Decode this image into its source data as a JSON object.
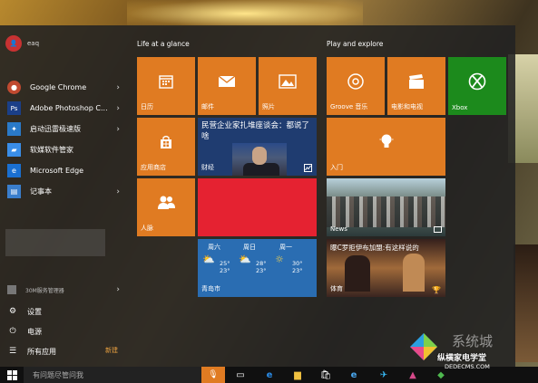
{
  "user": {
    "name": "eaq"
  },
  "apps": [
    {
      "label": "Google Chrome",
      "icon": "chrome-icon",
      "arrow": true,
      "color": "#c04a30"
    },
    {
      "label": "Adobe Photoshop C...",
      "icon": "photoshop-icon",
      "arrow": true,
      "color": "#1b3f88"
    },
    {
      "label": "启动迅雷极速版",
      "icon": "thunder-icon",
      "arrow": true,
      "color": "#2a7ac8"
    },
    {
      "label": "软媒软件管家",
      "icon": "software-manager-icon",
      "arrow": false,
      "color": "#3a8ee8"
    },
    {
      "label": "Microsoft Edge",
      "icon": "edge-icon",
      "arrow": false,
      "color": "#1a6fd0"
    },
    {
      "label": "记事本",
      "icon": "notepad-icon",
      "arrow": true,
      "color": "#3a7ecc"
    }
  ],
  "blurred_item": "",
  "small_item": "30M服务管理器",
  "bottom": {
    "settings": "设置",
    "power": "电源",
    "all_apps": "所有应用",
    "new": "新建"
  },
  "groups": {
    "life": "Life at a glance",
    "play": "Play and explore"
  },
  "tiles": {
    "calendar": "日历",
    "mail": "邮件",
    "photos": "照片",
    "groove": "Groove 音乐",
    "movies": "电影和电视",
    "xbox": "Xbox",
    "store": "应用商店",
    "getstarted": "入门",
    "people": "人脉",
    "news_headline": "民营企业家扎堆座谈会：都说了啥",
    "news_caption": "财经",
    "news2_label": "News",
    "news2_headline": "曝C罗拒伊布加盟:有这样说的",
    "sports_caption": "体育",
    "weather_city": "青岛市"
  },
  "weather": [
    {
      "day": "周六",
      "high": "25°",
      "low": "23°"
    },
    {
      "day": "周日",
      "high": "28°",
      "low": "23°"
    },
    {
      "day": "周一",
      "high": "30°",
      "low": "23°"
    }
  ],
  "taskbar": {
    "search_placeholder": "有问题尽管问我",
    "icons": [
      "task-view-icon",
      "edge-icon",
      "file-explorer-icon",
      "store-icon",
      "ie-icon",
      "app-icon",
      "app2-icon",
      "app3-icon"
    ]
  },
  "watermark": {
    "text": "系统城",
    "brand": "纵横家电学堂",
    "url": "DEDECMS.COM"
  },
  "colors": {
    "accent": "#e07b22",
    "xbox": "#1c8a1c",
    "news": "#1f3c70",
    "weather": "#2a6db2",
    "red_tile": "#e52231"
  }
}
